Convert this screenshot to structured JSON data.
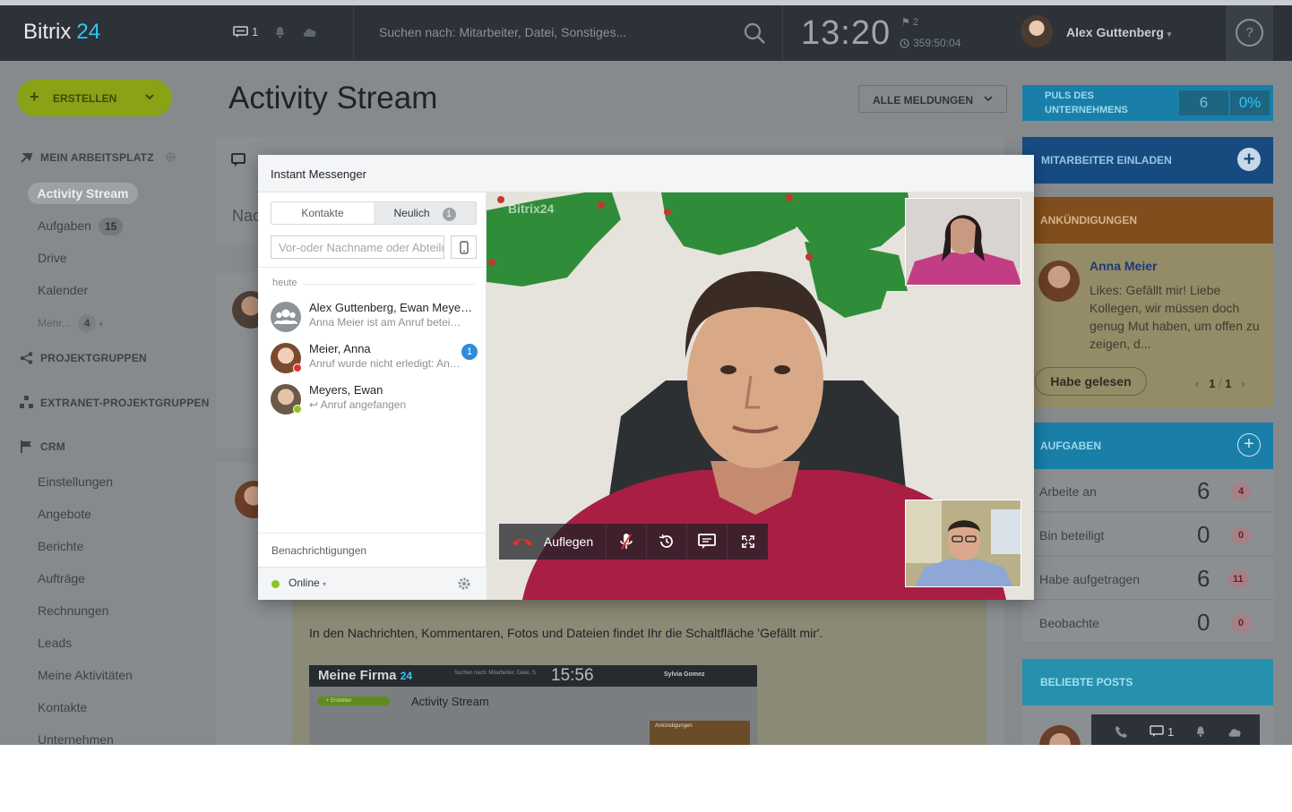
{
  "header": {
    "logo_main": "Bitrix",
    "logo_accent": "24",
    "chat_count": "1",
    "search_placeholder": "Suchen nach: Mitarbeiter, Datei, Sonstiges...",
    "time": "13:20",
    "flag_count": "2",
    "work_time": "359:50:04",
    "user_name": "Alex Guttenberg",
    "help_label": "?"
  },
  "sidebar": {
    "create_label": "ERSTELLEN",
    "workspace_label": "MEIN ARBEITSPLATZ",
    "active_item": "Activity Stream",
    "items": [
      {
        "label": "Aufgaben",
        "count": "15"
      },
      {
        "label": "Drive"
      },
      {
        "label": "Kalender"
      }
    ],
    "more_label": "Mehr...",
    "more_count": "4",
    "groups_label": "PROJEKTGRUPPEN",
    "extranet_label": "EXTRANET-PROJEKTGRUPPEN",
    "crm_label": "CRM",
    "crm_items": [
      "Einstellungen",
      "Angebote",
      "Berichte",
      "Aufträge",
      "Rechnungen",
      "Leads",
      "Meine Aktivitäten",
      "Kontakte",
      "Unternehmen"
    ]
  },
  "main": {
    "title": "Activity Stream",
    "filter_label": "ALLE MELDUNGEN",
    "composer_placeholder": "Nac",
    "post_text": "In den Nachrichten, Kommentaren, Fotos und Dateien findet Ihr die Schaltfläche 'Gefällt mir'.",
    "embedded": {
      "title": "Meine Firma",
      "accent": "24",
      "time": "15:56",
      "user": "Sylvia Gomez",
      "search": "Suchen nach: Mitarbeiter, Datei, S",
      "page_title": "Activity Stream",
      "create": "+ Erstellen",
      "panel": "Ankündigungen"
    }
  },
  "right": {
    "puls_label": "PULS DES UNTERNEHMENS",
    "puls_value": "6",
    "puls_percent": "0%",
    "invite_label": "MITARBEITER EINLADEN",
    "announcements_label": "ANKÜNDIGUNGEN",
    "announcement_author": "Anna Meier",
    "announcement_text": "Likes: Gefällt mir! Liebe Kollegen, wir müssen doch genug Mut haben, um offen zu zeigen, d...",
    "read_button": "Habe gelesen",
    "pager_current": "1",
    "pager_sep": "/",
    "pager_total": "1",
    "tasks_label": "AUFGABEN",
    "tasks": [
      {
        "label": "Arbeite an",
        "value": "6",
        "badge": "4"
      },
      {
        "label": "Bin beteiligt",
        "value": "0",
        "badge": "0"
      },
      {
        "label": "Habe aufgetragen",
        "value": "6",
        "badge": "11"
      },
      {
        "label": "Beobachte",
        "value": "0",
        "badge": "0"
      }
    ],
    "popular_label": "BELIEBTE POSTS",
    "mini_chat_count": "1"
  },
  "messenger": {
    "title": "Instant Messenger",
    "tab_contacts": "Kontakte",
    "tab_recent": "Neulich",
    "tab_recent_count": "1",
    "search_placeholder": "Vor-oder Nachname oder Abteilung",
    "section_today": "heute",
    "contacts": [
      {
        "name": "Alex Guttenberg, Ewan Meyers, Anna Meier",
        "sub": "Anna Meier ist am Anruf beteiligt"
      },
      {
        "name": "Meier, Anna",
        "sub": "Anruf wurde nicht erledigt: Anna Meier",
        "badge": "1"
      },
      {
        "name": "Meyers, Ewan",
        "sub": "↩ Anruf angefangen"
      }
    ],
    "notifications_label": "Benachrichtigungen",
    "status_label": "Online",
    "hangup_label": "Auflegen",
    "watermark": "Bitrix24",
    "status_colors": {
      "online": "#8fc31f",
      "busy": "#e0322e"
    }
  }
}
